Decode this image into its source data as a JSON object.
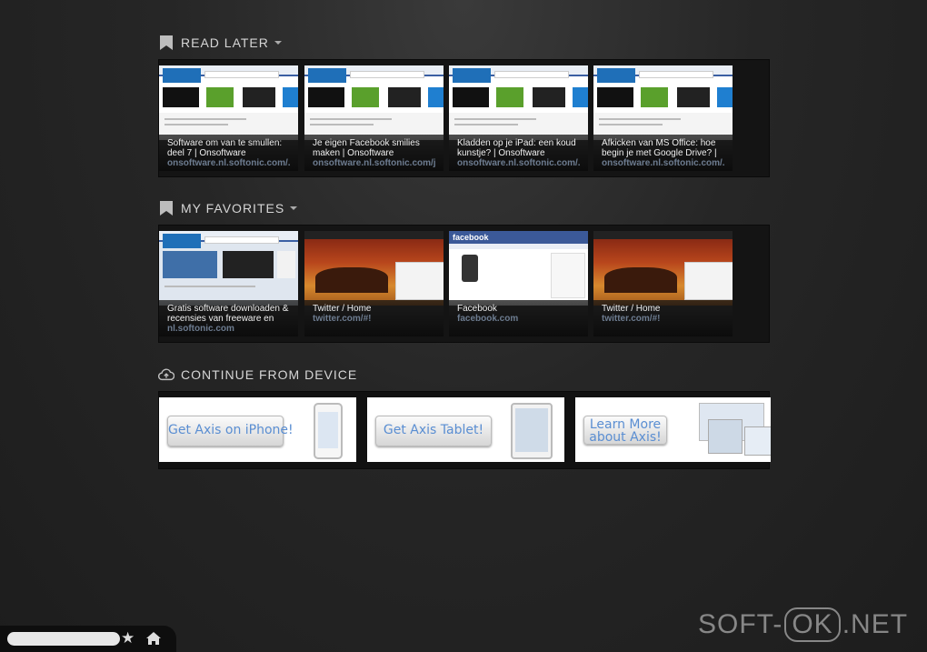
{
  "read_later": {
    "title": "READ LATER",
    "items": [
      {
        "title": "Software om van te smullen: deel 7 | Onsoftware",
        "url": "onsoftware.nl.softonic.com/..."
      },
      {
        "title": "Je eigen Facebook smilies maken | Onsoftware",
        "url": "onsoftware.nl.softonic.com/j..."
      },
      {
        "title": "Kladden op je iPad: een koud kunstje? | Onsoftware",
        "url": "onsoftware.nl.softonic.com/..."
      },
      {
        "title": "Afkicken van MS Office: hoe begin je met Google Drive? |",
        "url": "onsoftware.nl.softonic.com/..."
      }
    ]
  },
  "favorites": {
    "title": "MY FAVORITES",
    "items": [
      {
        "title": "Gratis software downloaden & recensies van freeware en",
        "url": "nl.softonic.com"
      },
      {
        "title": "Twitter / Home",
        "url": "twitter.com/#!"
      },
      {
        "title": "Facebook",
        "url": "facebook.com"
      },
      {
        "title": "Twitter / Home",
        "url": "twitter.com/#!"
      }
    ],
    "thumb_labels": {
      "facebook": "facebook"
    }
  },
  "continue": {
    "title": "CONTINUE FROM DEVICE",
    "cards": [
      {
        "label": "Get Axis on iPhone!"
      },
      {
        "label": "Get Axis Tablet!"
      },
      {
        "label_line1": "Learn More",
        "label_line2": "about Axis!"
      }
    ]
  },
  "bottom_bar": {
    "search_value": "",
    "star_icon": "star-icon",
    "home_icon": "home-icon"
  },
  "watermark": {
    "left": "SOFT-",
    "box": "OK",
    "right": ".NET"
  },
  "colors": {
    "accent": "#5a8ed2",
    "url_text": "#6d7c90"
  }
}
